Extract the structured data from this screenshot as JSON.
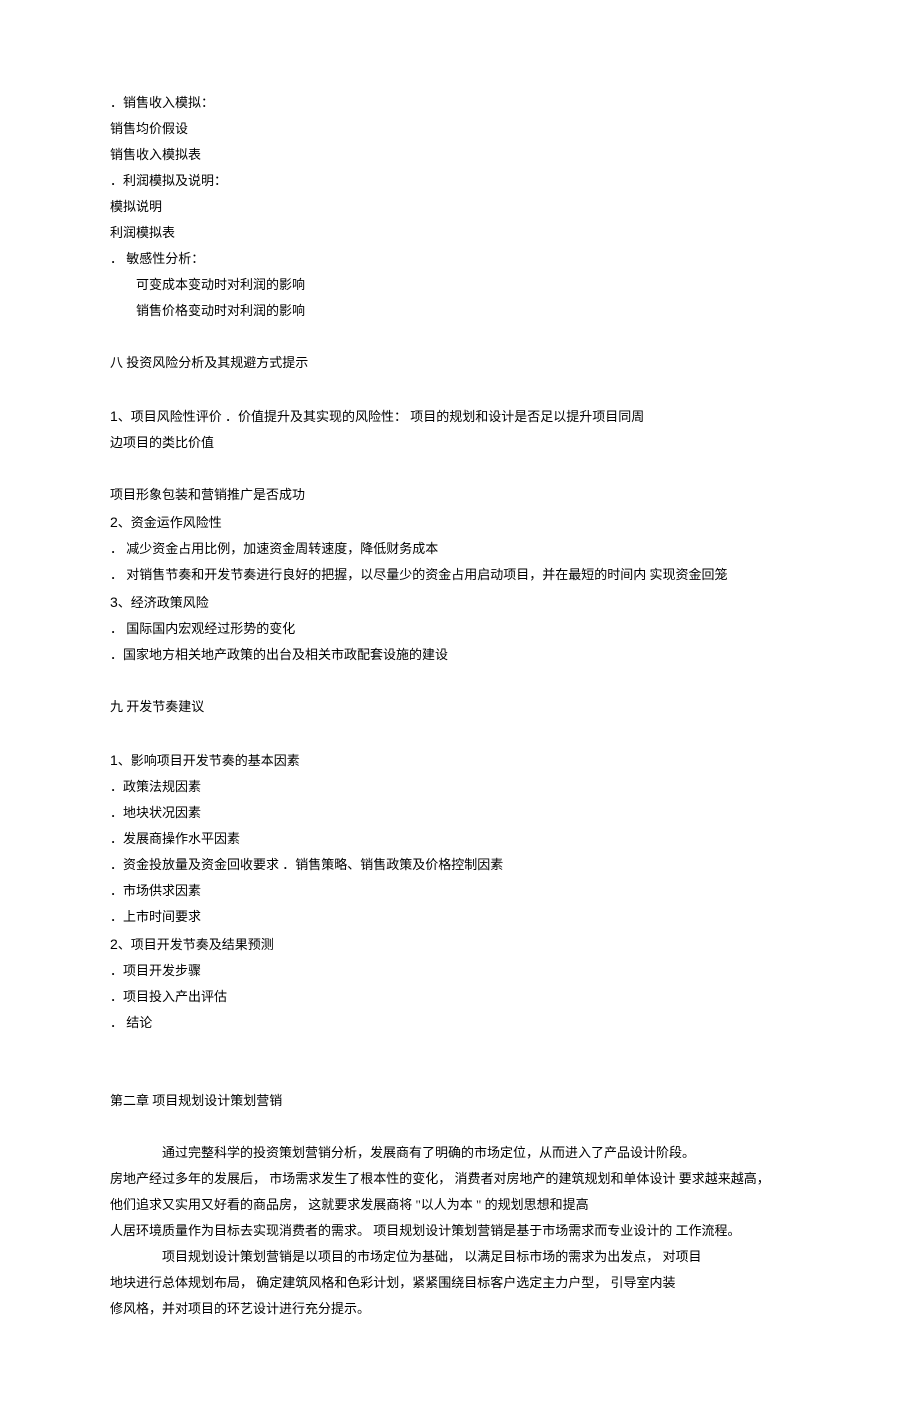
{
  "lines": {
    "l1": "．销售收入模拟：",
    "l2": "销售均价假设",
    "l3": "销售收入模拟表",
    "l4": "．利润模拟及说明：",
    "l5": "模拟说明",
    "l6": "利润模拟表",
    "l7": "．  敏感性分析：",
    "l8": "可变成本变动时对利润的影响",
    "l9": "销售价格变动时对利润的影响",
    "l10": "八  投资风险分析及其规避方式提示",
    "l11a_num": "1",
    "l11a": "、项目风险性评价 ．价值提升及其实现的风险性：  项目的规划和设计是否足以提升项目同周",
    "l11b": "边项目的类比价值",
    "l12": "项目形象包装和营销推广是否成功",
    "l13_num": "2",
    "l13": "、资金运作风险性",
    "l14": "．  减少资金占用比例，加速资金周转速度，降低财务成本",
    "l15": "．  对销售节奏和开发节奏进行良好的把握，以尽量少的资金占用启动项目，并在最短的时间内 实现资金回笼",
    "l16_num": "3",
    "l16": "、经济政策风险",
    "l17": "．  国际国内宏观经过形势的变化",
    "l18": "．国家地方相关地产政策的出台及相关市政配套设施的建设",
    "l19": "九  开发节奏建议",
    "l20_num": "1",
    "l20": "、影响项目开发节奏的基本因素",
    "l21": "．政策法规因素",
    "l22": "．地块状况因素",
    "l23": "．发展商操作水平因素",
    "l24": "．资金投放量及资金回收要求 ．销售策略、销售政策及价格控制因素",
    "l25": "．市场供求因素",
    "l26": "．上市时间要求",
    "l27_num": "2",
    "l27": "、项目开发节奏及结果预测",
    "l28": "．项目开发步骤",
    "l29": "．项目投入产出评估",
    "l30": "．  结论",
    "l31": "第二章 项目规划设计策划营销",
    "l32": "通过完整科学的投资策划营销分析，发展商有了明确的市场定位，从而进入了产品设计阶段。",
    "l33": "房地产经过多年的发展后，  市场需求发生了根本性的变化，  消费者对房地产的建筑规划和单体设计 要求越来越高，",
    "l34": "他们追求又实用又好看的商品房，  这就要求发展商将 \"以人为本  \" 的规划思想和提高",
    "l35": "人居环境质量作为目标去实现消费者的需求。  项目规划设计策划营销是基于市场需求而专业设计的 工作流程。",
    "l36": "项目规划设计策划营销是以项目的市场定位为基础，  以满足目标市场的需求为出发点，  对项目",
    "l37": "地块进行总体规划布局，  确定建筑风格和色彩计划，紧紧围绕目标客户选定主力户型，  引导室内装",
    "l38": "修风格，并对项目的环艺设计进行充分提示。"
  }
}
